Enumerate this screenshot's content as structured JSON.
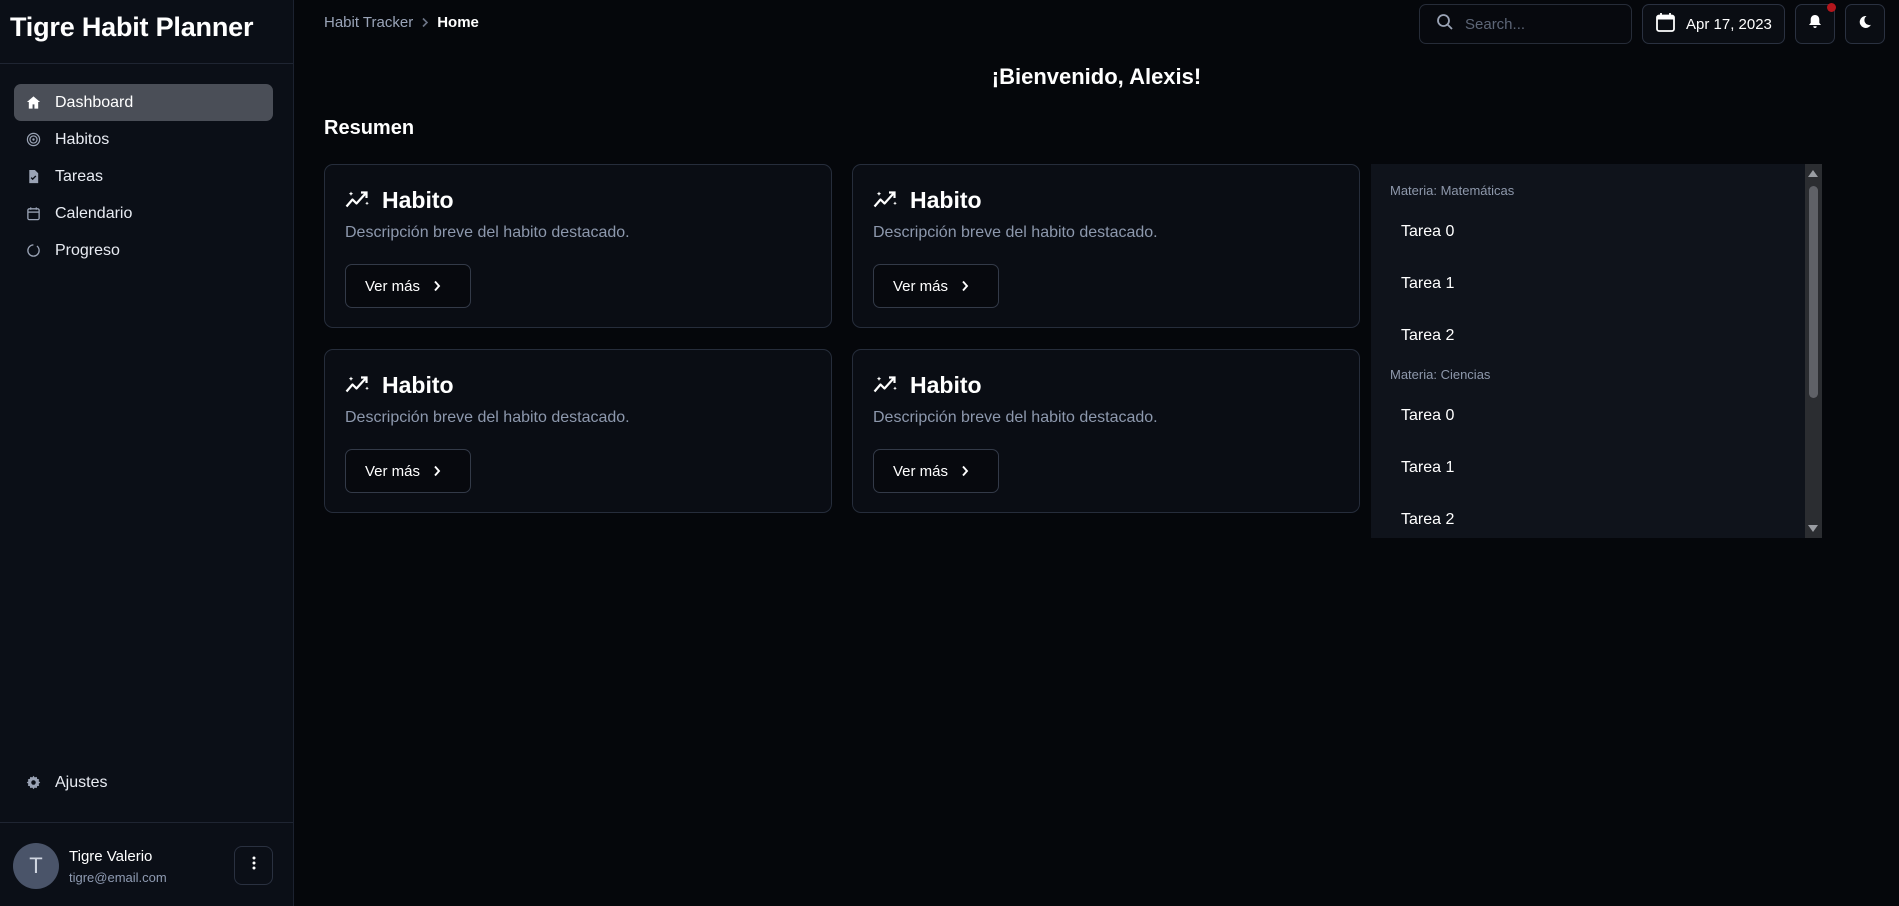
{
  "app": {
    "title": "Tigre Habit Planner"
  },
  "sidebar": {
    "items": [
      {
        "label": "Dashboard",
        "icon": "home-icon",
        "active": true
      },
      {
        "label": "Habitos",
        "icon": "target-icon",
        "active": false
      },
      {
        "label": "Tareas",
        "icon": "clipboard-icon",
        "active": false
      },
      {
        "label": "Calendario",
        "icon": "calendar-icon",
        "active": false
      },
      {
        "label": "Progreso",
        "icon": "progress-icon",
        "active": false
      }
    ],
    "settings_label": "Ajustes",
    "user": {
      "initial": "T",
      "name": "Tigre Valerio",
      "email": "tigre@email.com"
    }
  },
  "header": {
    "breadcrumb": {
      "parent": "Habit Tracker",
      "current": "Home"
    },
    "search_placeholder": "Search...",
    "date": "Apr 17, 2023"
  },
  "main": {
    "welcome": "¡Bienvenido, Alexis!",
    "section_title": "Resumen",
    "cards": [
      {
        "title": "Habito",
        "description": "Descripción breve del habito destacado.",
        "button": "Ver más"
      },
      {
        "title": "Habito",
        "description": "Descripción breve del habito destacado.",
        "button": "Ver más"
      },
      {
        "title": "Habito",
        "description": "Descripción breve del habito destacado.",
        "button": "Ver más"
      },
      {
        "title": "Habito",
        "description": "Descripción breve del habito destacado.",
        "button": "Ver más"
      }
    ]
  },
  "tasks": {
    "groups": [
      {
        "subject": "Materia: Matemáticas",
        "items": [
          "Tarea 0",
          "Tarea 1",
          "Tarea 2"
        ]
      },
      {
        "subject": "Materia: Ciencias",
        "items": [
          "Tarea 0",
          "Tarea 1",
          "Tarea 2"
        ]
      }
    ]
  },
  "colors": {
    "background": "#05070b",
    "sidebar": "#0b0f17",
    "active": "#4a4e57",
    "notification": "#b3161c"
  }
}
